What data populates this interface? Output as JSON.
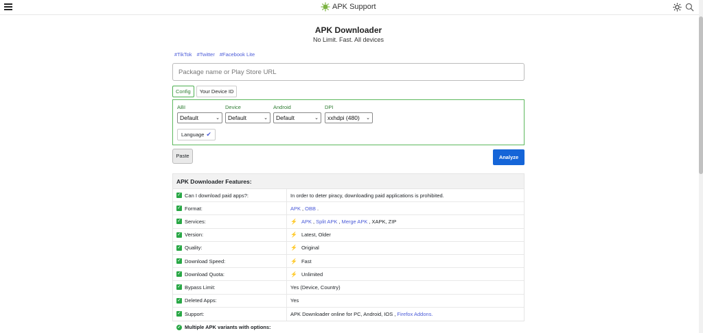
{
  "header": {
    "brand": "APK Support",
    "icons": {
      "menu": "hamburger-icon",
      "logo": "virus-logo-icon",
      "theme": "sun-icon",
      "search": "search-icon"
    }
  },
  "main": {
    "title": "APK Downloader",
    "subtitle": "No Limit. Fast. All devices",
    "tags": [
      "#TikTok",
      "#Twitter",
      "#Facebook Lite"
    ],
    "search_placeholder": "Package name or Play Store URL",
    "tabs": [
      "Config",
      "Your Device ID"
    ],
    "config": {
      "abi_label": "ABI",
      "abi_value": "Default",
      "device_label": "Device",
      "device_value": "Default",
      "android_label": "Android",
      "android_value": "Default",
      "dpi_label": "DPI",
      "dpi_value": "xxhdpi (480)",
      "language_label": "Language"
    },
    "paste_label": "Paste",
    "analyze_label": "Analyze"
  },
  "features": {
    "title": "APK Downloader Features:",
    "rows": [
      {
        "label": "Can I download paid apps?:",
        "value": "In order to deter piracy, downloading paid applications is prohibited."
      },
      {
        "label": "Format:",
        "links": [
          "APK",
          "OBB"
        ]
      },
      {
        "label": "Services:",
        "links": [
          "APK",
          "Split APK",
          "Merge APK"
        ],
        "tail": "XAPK, ZIP"
      },
      {
        "label": "Version:",
        "value": "Latest, Older"
      },
      {
        "label": "Quality:",
        "value": "Original"
      },
      {
        "label": "Download Speed:",
        "value": "Fast"
      },
      {
        "label": "Download Quota:",
        "value": "Unlimited"
      },
      {
        "label": "Bypass Limit:",
        "value": "Yes (Device, Country)"
      },
      {
        "label": "Deleted Apps:",
        "value": "Yes"
      },
      {
        "label": "Support:",
        "value": "APK Downloader online for PC, Android, IOS ,",
        "link": "Firefox Addons."
      }
    ],
    "footer_note": "Multiple APK variants with options:"
  },
  "colors": {
    "accent_green": "#28a745",
    "link_blue": "#4b5bd8",
    "analyze_blue": "#1565d8",
    "bolt_orange": "#f57c00"
  }
}
